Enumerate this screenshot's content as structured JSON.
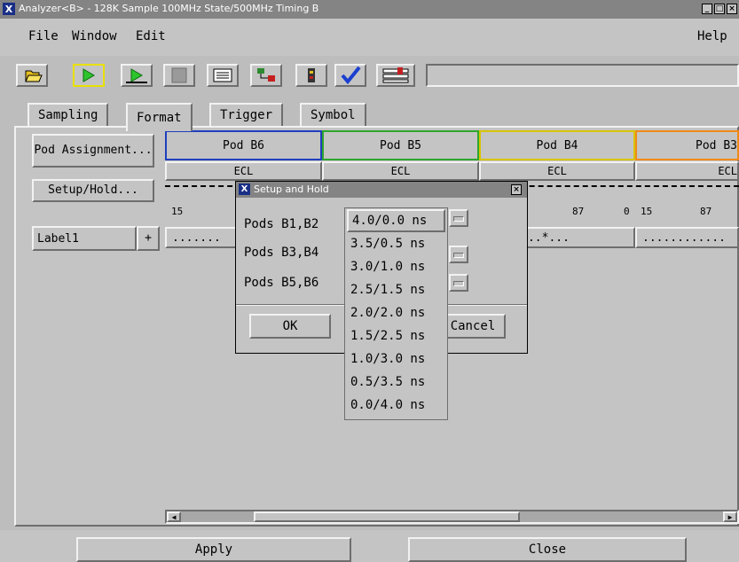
{
  "window": {
    "title": "Analyzer<B> - 128K Sample 100MHz State/500MHz Timing B",
    "controls": [
      "_",
      "□",
      "×"
    ]
  },
  "menu": {
    "file": "File",
    "window": "Window",
    "edit": "Edit",
    "help": "Help"
  },
  "toolbar": {
    "icons": [
      "open-folder-icon",
      "run-icon",
      "run-repetitive-icon",
      "stop-icon",
      "list-icon",
      "overview-icon",
      "config-icon",
      "check-icon",
      "settings-icon"
    ],
    "status_text": ""
  },
  "tabs": [
    "Sampling",
    "Format",
    "Trigger",
    "Symbol"
  ],
  "active_tab": "Format",
  "side_buttons": {
    "pod_assignment": "Pod Assignment...",
    "setup_hold": "Setup/Hold...",
    "label": "Label1",
    "label_add": "+"
  },
  "pods": [
    {
      "name": "Pod B6",
      "threshold": "ECL",
      "color": "#1f3fbf",
      "bits_hi": "15",
      "bits_mid": "",
      "bits_lo": "",
      "pattern": "......."
    },
    {
      "name": "Pod B5",
      "threshold": "ECL",
      "color": "#2ea52e",
      "bits_hi": "",
      "bits_mid": "",
      "bits_lo": "",
      "pattern": ""
    },
    {
      "name": "Pod B4",
      "threshold": "ECL",
      "color": "#d8c400",
      "bits_hi": "",
      "bits_mid": "87",
      "bits_lo": "0",
      "pattern": "........*..."
    },
    {
      "name": "Pod B3",
      "threshold": "ECL",
      "color": "#f08a18",
      "bits_hi": "15",
      "bits_mid": "87",
      "bits_lo": "",
      "pattern": "............"
    }
  ],
  "dialog": {
    "title": "Setup and Hold",
    "close": "×",
    "rows": [
      {
        "label": "Pods B1,B2",
        "value": "4.0/0.0 ns"
      },
      {
        "label": "Pods B3,B4",
        "value": ""
      },
      {
        "label": "Pods B5,B6",
        "value": ""
      }
    ],
    "ok": "OK",
    "cancel": "Cancel"
  },
  "dropdown": {
    "options": [
      "4.0/0.0 ns",
      "3.5/0.5 ns",
      "3.0/1.0 ns",
      "2.5/1.5 ns",
      "2.0/2.0 ns",
      "1.5/2.5 ns",
      "1.0/3.0 ns",
      "0.5/3.5 ns",
      "0.0/4.0 ns"
    ],
    "selected": "4.0/0.0 ns"
  },
  "bottom": {
    "apply": "Apply",
    "close": "Close"
  },
  "colors": {
    "title_bg": "#848484",
    "panel": "#c4c4c4",
    "x_icon": "#1a2f86"
  }
}
